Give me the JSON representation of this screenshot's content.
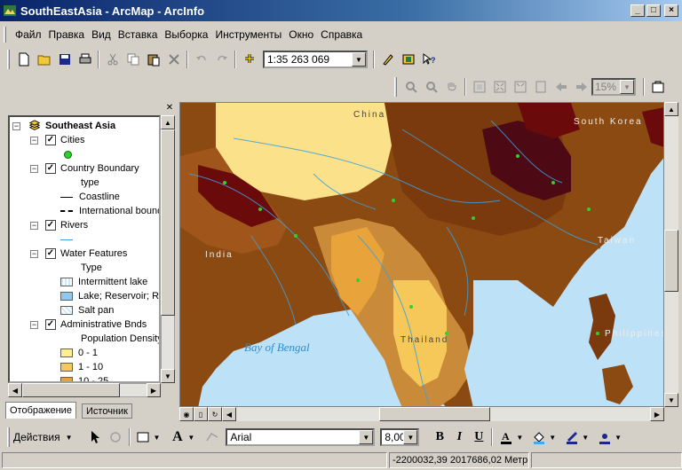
{
  "window": {
    "title": "SouthEastAsia - ArcMap - ArcInfo",
    "buttons": {
      "minimize": "_",
      "maximize": "□",
      "close": "×"
    }
  },
  "menu": [
    "Файл",
    "Правка",
    "Вид",
    "Вставка",
    "Выборка",
    "Инструменты",
    "Окно",
    "Справка"
  ],
  "toolbar": {
    "scale_value": "1:35 263 069",
    "zoom_value": "15%"
  },
  "toc": {
    "rows": [
      {
        "label": "Southeast Asia"
      },
      {
        "label": "Cities"
      },
      {
        "label": "Country Boundary"
      },
      {
        "label": "type"
      },
      {
        "label": "Coastline"
      },
      {
        "label": "International bound"
      },
      {
        "label": "Rivers"
      },
      {
        "label": "Water Features"
      },
      {
        "label": "Type"
      },
      {
        "label": "Intermittent lake"
      },
      {
        "label": "Lake; Reservoir; R"
      },
      {
        "label": "Salt pan"
      },
      {
        "label": "Administrative Bnds"
      },
      {
        "label": "Population Density"
      },
      {
        "label": "0 - 1"
      },
      {
        "label": "1 - 10"
      },
      {
        "label": "10 - 25"
      }
    ],
    "tabs": [
      "Отображение",
      "Источник"
    ]
  },
  "map_labels": {
    "china": "China",
    "south_korea": "South Korea",
    "taiwan": "Taiwan",
    "india": "India",
    "philippines": "Philippines",
    "bay_of_bengal": "Bay of Bengal",
    "thailand": "Thailand"
  },
  "drawing": {
    "label": "Действия",
    "font": "Arial",
    "size": "8,00",
    "bold": "B",
    "italic": "I",
    "underline": "U",
    "text_tool": "A"
  },
  "status": {
    "coordinates": "-2200032,39  2017686,02 Метр"
  },
  "colors": {
    "density_0_1": "#fdf08a",
    "density_1_10": "#f6c85a",
    "density_10_25": "#e8a33a"
  }
}
